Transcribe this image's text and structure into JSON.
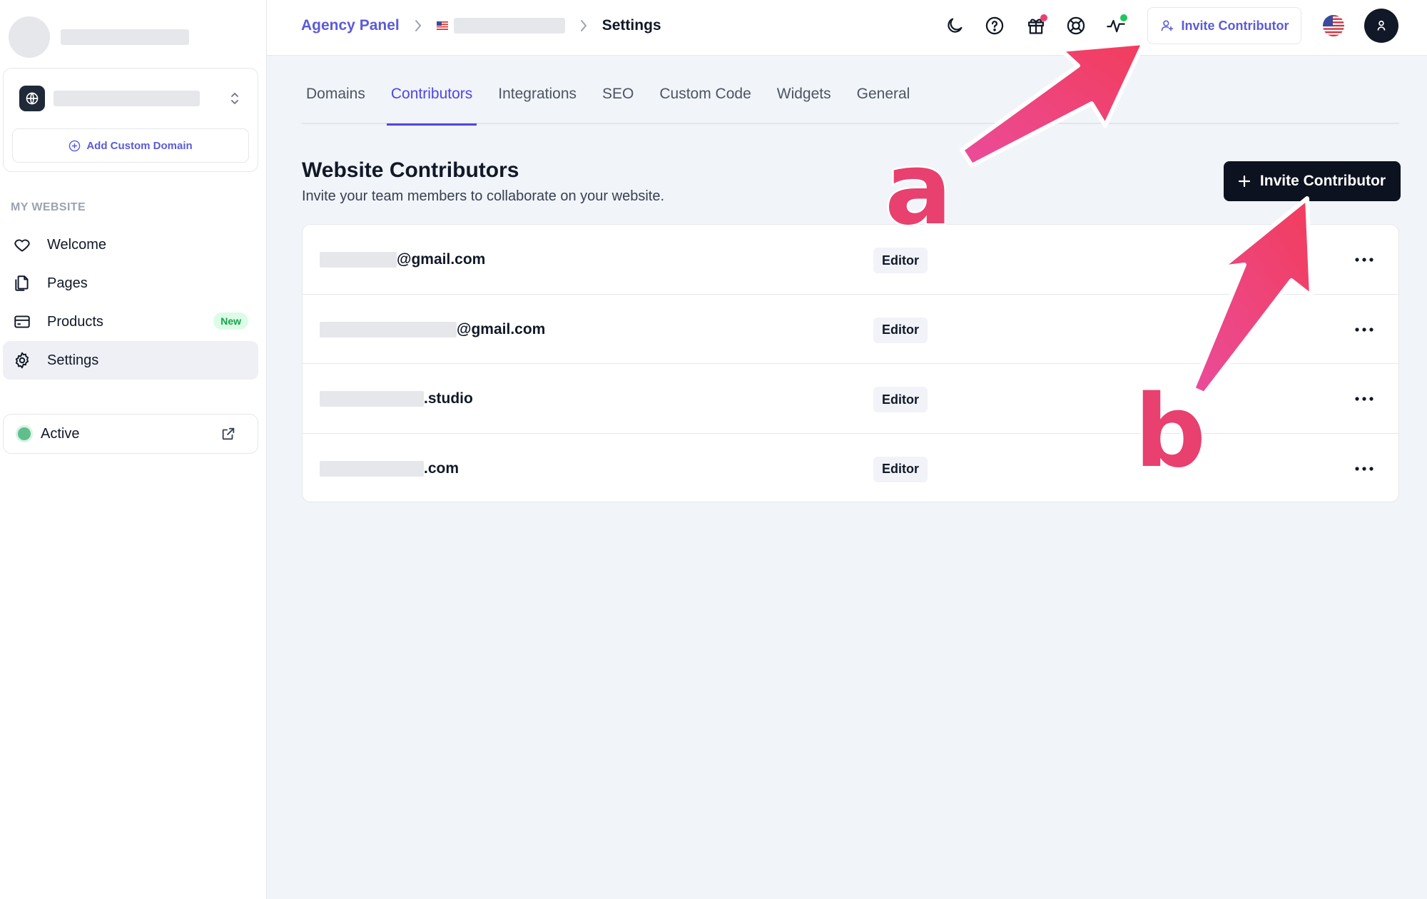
{
  "sidebar": {
    "add_custom_domain": "Add Custom Domain",
    "section_label": "MY WEBSITE",
    "items": [
      {
        "label": "Welcome",
        "icon": "heart-icon"
      },
      {
        "label": "Pages",
        "icon": "pages-icon"
      },
      {
        "label": "Products",
        "icon": "card-icon",
        "badge": "New"
      },
      {
        "label": "Settings",
        "icon": "gear-icon",
        "active": true
      }
    ],
    "status": {
      "label": "Active",
      "color": "#5fbf8c"
    }
  },
  "topbar": {
    "breadcrumb": {
      "root": "Agency Panel",
      "current": "Settings"
    },
    "icons": [
      "moon-icon",
      "help-icon",
      "gift-icon",
      "lifebuoy-icon",
      "activity-icon"
    ],
    "notif_colors": {
      "gift": "#e8406f",
      "activity": "#22c55e"
    },
    "invite_label": "Invite Contributor"
  },
  "tabs": [
    {
      "label": "Domains"
    },
    {
      "label": "Contributors",
      "active": true
    },
    {
      "label": "Integrations"
    },
    {
      "label": "SEO"
    },
    {
      "label": "Custom Code"
    },
    {
      "label": "Widgets"
    },
    {
      "label": "General"
    }
  ],
  "main": {
    "title": "Website Contributors",
    "subtitle": "Invite your team members to collaborate on your website.",
    "invite_button": "Invite Contributor",
    "contributors": [
      {
        "email_suffix": "@gmail.com",
        "role": "Editor"
      },
      {
        "email_suffix": "@gmail.com",
        "role": "Editor"
      },
      {
        "email_suffix": ".studio",
        "role": "Editor"
      },
      {
        "email_suffix": ".com",
        "role": "Editor"
      }
    ]
  },
  "annotations": {
    "a": "a",
    "b": "b",
    "color": "#e8406f"
  },
  "colors": {
    "accent": "#4f46e5",
    "link": "#5b5bd6",
    "primary_button": "#0d1220"
  }
}
